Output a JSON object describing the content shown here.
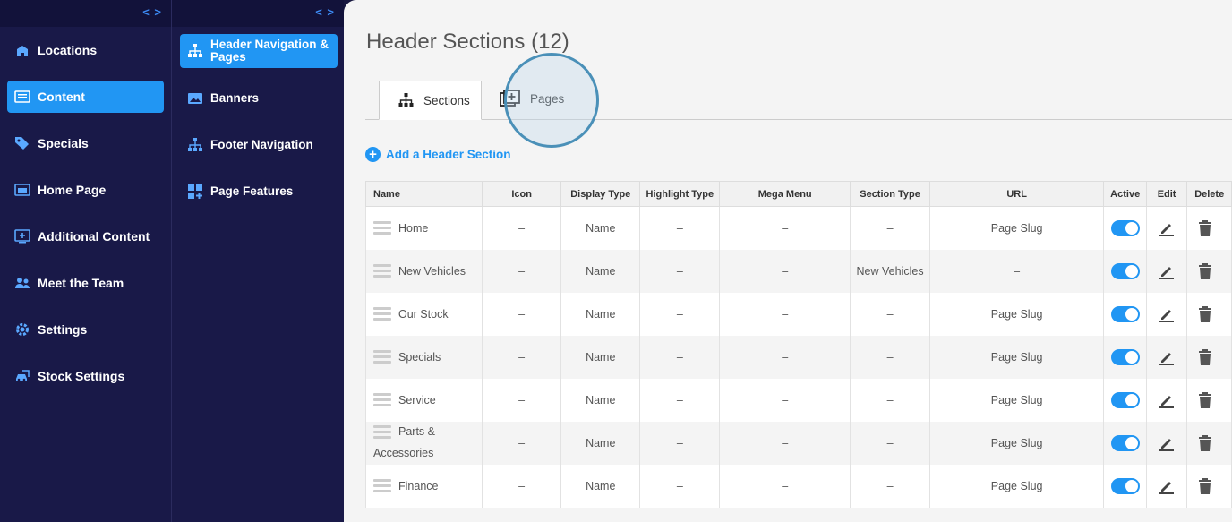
{
  "sidebar": {
    "items": [
      {
        "label": "Locations",
        "icon": "building-icon"
      },
      {
        "label": "Content",
        "icon": "content-icon",
        "active": true
      },
      {
        "label": "Specials",
        "icon": "tag-icon"
      },
      {
        "label": "Home Page",
        "icon": "homepage-icon"
      },
      {
        "label": "Additional Content",
        "icon": "add-content-icon"
      },
      {
        "label": "Meet the Team",
        "icon": "team-icon"
      },
      {
        "label": "Settings",
        "icon": "gear-icon"
      },
      {
        "label": "Stock Settings",
        "icon": "car-icon"
      }
    ]
  },
  "subnav": {
    "items": [
      {
        "label": "Header Navigation & Pages",
        "icon": "sitemap-icon",
        "active": true
      },
      {
        "label": "Banners",
        "icon": "image-icon"
      },
      {
        "label": "Footer Navigation",
        "icon": "sitemap-icon"
      },
      {
        "label": "Page Features",
        "icon": "grid-plus-icon"
      }
    ]
  },
  "main": {
    "title": "Header Sections (12)",
    "tabs": [
      {
        "label": "Sections",
        "active": true
      },
      {
        "label": "Pages"
      }
    ],
    "add_label": "Add a Header Section",
    "table": {
      "columns": [
        "Name",
        "Icon",
        "Display Type",
        "Highlight Type",
        "Mega Menu",
        "Section Type",
        "URL",
        "Active",
        "Edit",
        "Delete"
      ],
      "rows": [
        {
          "name": "Home",
          "icon": "–",
          "display": "Name",
          "highlight": "–",
          "mega": "–",
          "section": "–",
          "url": "Page Slug"
        },
        {
          "name": "New Vehicles",
          "icon": "–",
          "display": "Name",
          "highlight": "–",
          "mega": "–",
          "section": "New Vehicles",
          "url": "–"
        },
        {
          "name": "Our Stock",
          "icon": "–",
          "display": "Name",
          "highlight": "–",
          "mega": "–",
          "section": "–",
          "url": "Page Slug"
        },
        {
          "name": "Specials",
          "icon": "–",
          "display": "Name",
          "highlight": "–",
          "mega": "–",
          "section": "–",
          "url": "Page Slug"
        },
        {
          "name": "Service",
          "icon": "–",
          "display": "Name",
          "highlight": "–",
          "mega": "–",
          "section": "–",
          "url": "Page Slug"
        },
        {
          "name": "Parts & Accessories",
          "icon": "–",
          "display": "Name",
          "highlight": "–",
          "mega": "–",
          "section": "–",
          "url": "Page Slug"
        },
        {
          "name": "Finance",
          "icon": "–",
          "display": "Name",
          "highlight": "–",
          "mega": "–",
          "section": "–",
          "url": "Page Slug"
        }
      ]
    }
  },
  "colors": {
    "accent": "#2196f3",
    "sidebar_bg": "#191948"
  }
}
